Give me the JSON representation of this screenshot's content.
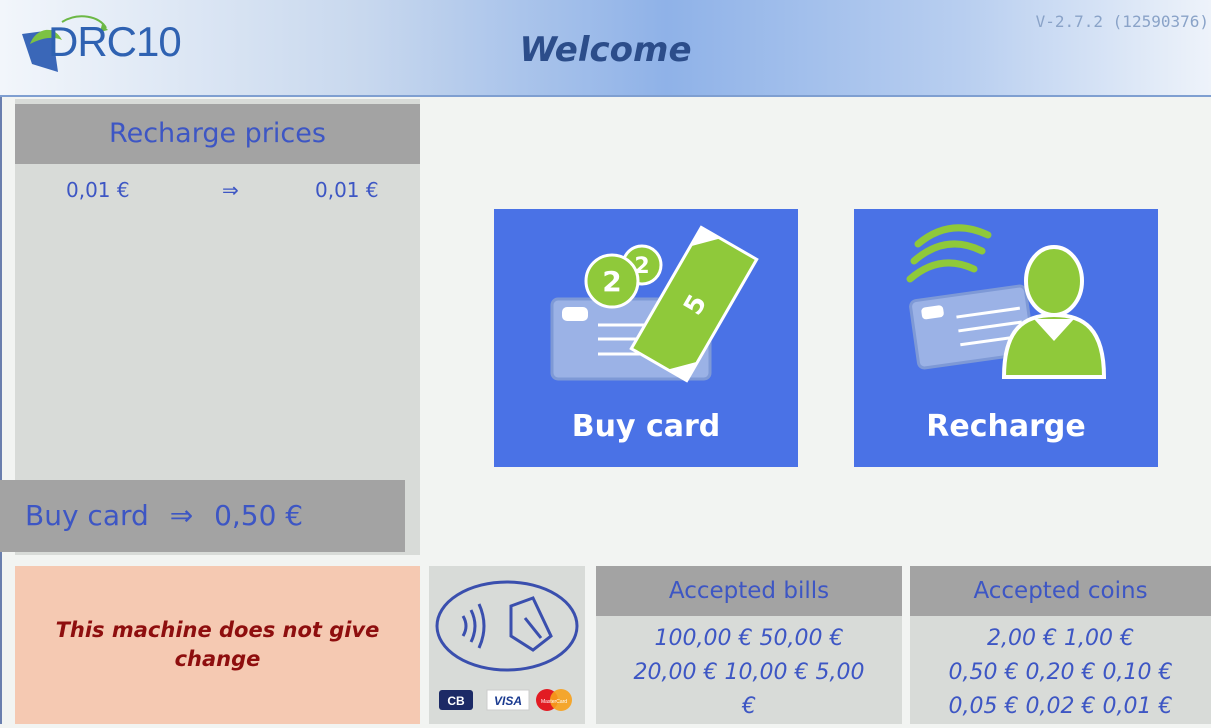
{
  "header": {
    "logo_text": "DRC10",
    "title": "Welcome",
    "version": "V-2.7.2 (12590376)"
  },
  "recharge_prices": {
    "title": "Recharge prices",
    "rows": [
      {
        "from": "0,01 €",
        "arrow": "⇒",
        "to": "0,01 €"
      }
    ]
  },
  "buy_card_price": {
    "label": "Buy card",
    "arrow": "⇒",
    "price": "0,50 €"
  },
  "actions": {
    "buy_card_label": "Buy card",
    "recharge_label": "Recharge"
  },
  "notice": {
    "text": "This machine does not give change"
  },
  "payment": {
    "card_logos": [
      "CB",
      "VISA",
      "MasterCard"
    ]
  },
  "accepted_bills": {
    "title": "Accepted bills",
    "line1": "100,00 € 50,00 €",
    "line2": "20,00 € 10,00 € 5,00",
    "line3": "€"
  },
  "accepted_coins": {
    "title": "Accepted coins",
    "line1": "2,00 € 1,00 €",
    "line2": "0,50 € 0,20 € 0,10 €",
    "line3": "0,05 € 0,02 € 0,01 €"
  },
  "colors": {
    "accent_blue": "#4a72e6",
    "text_blue": "#3d56c4",
    "panel_gray": "#a3a3a3",
    "notice_bg": "#f5c9b2",
    "notice_text": "#8e0e0e",
    "icon_green": "#8fc93a"
  }
}
